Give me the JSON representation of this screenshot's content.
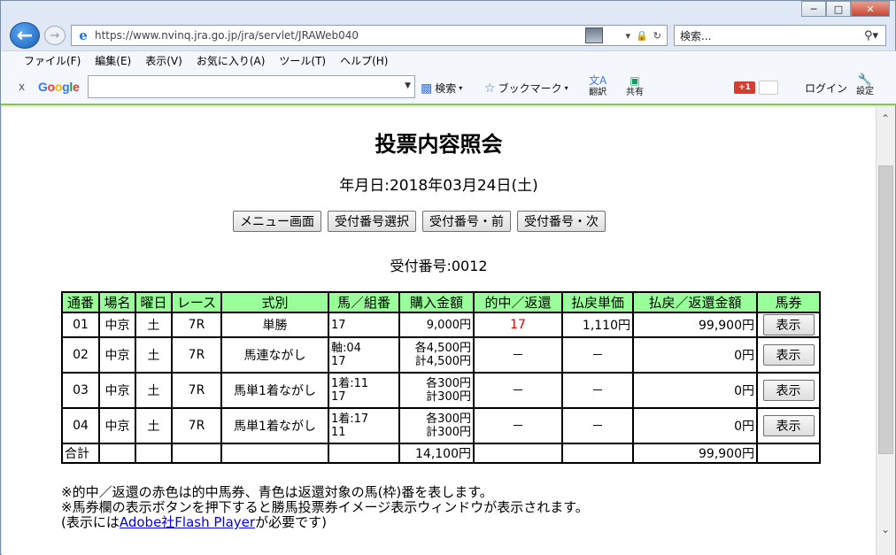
{
  "window": {
    "minimize": "─",
    "maximize": "□",
    "close": "✕"
  },
  "browser": {
    "url": "https://www.nvinq.jra.go.jp/jra/servlet/JRAWeb040",
    "search_placeholder": "検索...",
    "menu": [
      "ファイル(F)",
      "編集(E)",
      "表示(V)",
      "お気に入り(A)",
      "ツール(T)",
      "ヘルプ(H)"
    ],
    "google_toolbar": {
      "close": "x",
      "search_label": "検索",
      "bookmark_label": "ブックマーク",
      "translate_label": "翻訳",
      "share_label": "共有",
      "gplus_label": "+1",
      "login_label": "ログイン",
      "settings_label": "設定"
    }
  },
  "page": {
    "title": "投票内容照会",
    "date_line": "年月日:2018年03月24日(土)",
    "buttons": {
      "menu": "メニュー画面",
      "select": "受付番号選択",
      "prev": "受付番号・前",
      "next": "受付番号・次"
    },
    "ticket_number": "受付番号:0012",
    "table": {
      "headers": [
        "通番",
        "場名",
        "曜日",
        "レース",
        "式別",
        "馬／組番",
        "購入金額",
        "的中／返還",
        "払戻単価",
        "払戻／返還金額",
        "馬券"
      ],
      "rows": [
        {
          "no": "01",
          "venue": "中京",
          "day": "土",
          "race": "7R",
          "type": "単勝",
          "horse1": "17",
          "horse2": "",
          "amount1": "9,000円",
          "amount2": "",
          "hit": "17",
          "unit": "1,110円",
          "payout": "99,900円",
          "ticket": "表示"
        },
        {
          "no": "02",
          "venue": "中京",
          "day": "土",
          "race": "7R",
          "type": "馬連ながし",
          "horse1": "軸:04",
          "horse2": "17",
          "amount1": "各4,500円",
          "amount2": "計4,500円",
          "hit": "－",
          "unit": "－",
          "payout": "0円",
          "ticket": "表示"
        },
        {
          "no": "03",
          "venue": "中京",
          "day": "土",
          "race": "7R",
          "type": "馬単1着ながし",
          "horse1": "1着:11",
          "horse2": "17",
          "amount1": "各300円",
          "amount2": "計300円",
          "hit": "－",
          "unit": "－",
          "payout": "0円",
          "ticket": "表示"
        },
        {
          "no": "04",
          "venue": "中京",
          "day": "土",
          "race": "7R",
          "type": "馬単1着ながし",
          "horse1": "1着:17",
          "horse2": "11",
          "amount1": "各300円",
          "amount2": "計300円",
          "hit": "－",
          "unit": "－",
          "payout": "0円",
          "ticket": "表示"
        }
      ],
      "total": {
        "label": "合計",
        "amount": "14,100円",
        "payout": "99,900円"
      }
    },
    "notes": {
      "line1": "※的中／返還の赤色は的中馬券、青色は返還対象の馬(枠)番を表します。",
      "line2": "※馬券欄の表示ボタンを押下すると勝馬投票券イメージ表示ウィンドウが表示されます。",
      "line3_prefix": "(表示には",
      "line3_link": "Adobe社Flash Player",
      "line3_suffix": "が必要です)"
    }
  },
  "colors": {
    "header_bg": "#99ff99",
    "hit_red": "#e00000",
    "link_blue": "#0000ee",
    "google_bar_accent": "#8cc63f"
  }
}
